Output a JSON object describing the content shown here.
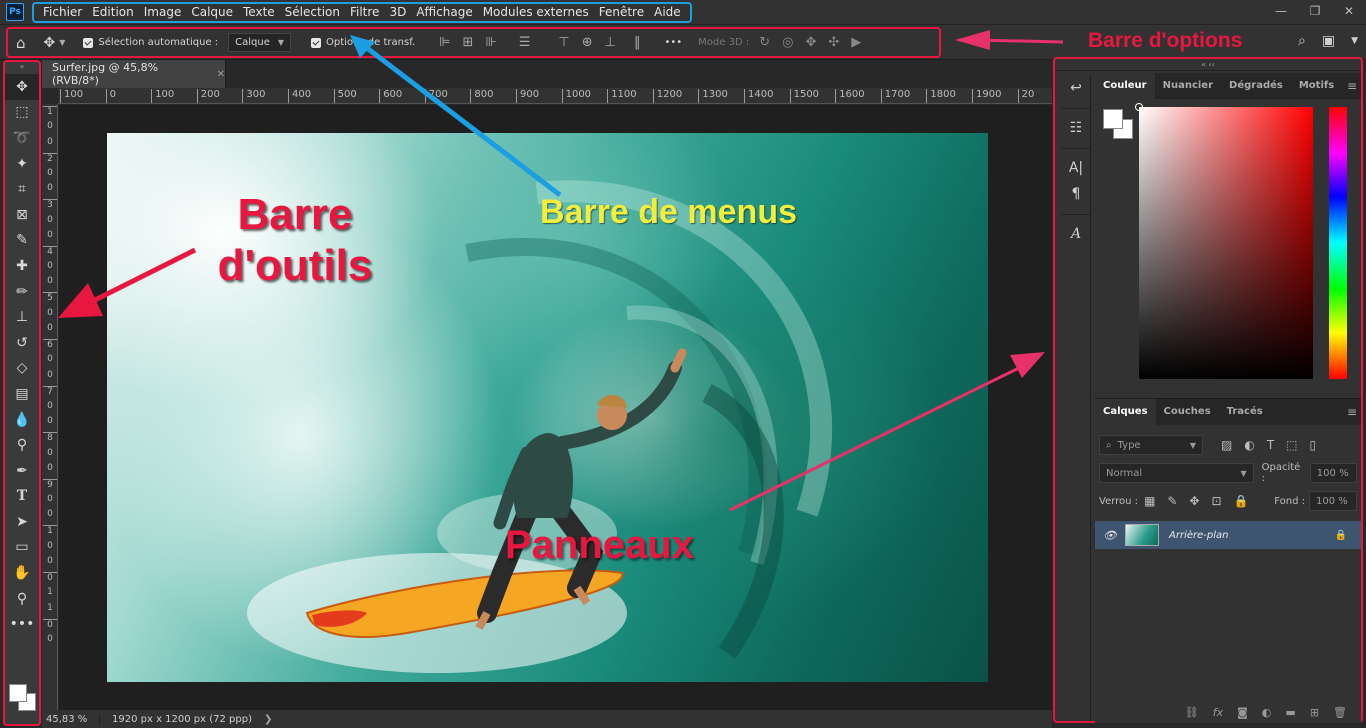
{
  "app": {
    "logo": "Ps"
  },
  "menu": {
    "items": [
      "Fichier",
      "Edition",
      "Image",
      "Calque",
      "Texte",
      "Sélection",
      "Filtre",
      "3D",
      "Affichage",
      "Modules externes",
      "Fenêtre",
      "Aide"
    ]
  },
  "window_controls": {
    "minimize": "—",
    "restore": "❐",
    "close": "✕"
  },
  "options": {
    "auto_select": "Sélection automatique :",
    "layer_dropdown": "Calque",
    "transform_controls": "Options de transf.",
    "mode3d": "Mode 3D :",
    "more": "•••"
  },
  "document": {
    "tab_title": "Surfer.jpg @ 45,8% (RVB/8*)",
    "ruler_h": [
      "100",
      "0",
      "100",
      "200",
      "300",
      "400",
      "500",
      "600",
      "700",
      "800",
      "900",
      "1000",
      "1100",
      "1200",
      "1300",
      "1400",
      "1500",
      "1600",
      "1700",
      "1800",
      "1900",
      "20"
    ],
    "ruler_v": [
      "1",
      "0",
      "0",
      "2",
      "0",
      "0",
      "3",
      "0",
      "0",
      "4",
      "0",
      "0",
      "5",
      "0",
      "0",
      "6",
      "0",
      "0",
      "7",
      "0",
      "0",
      "8",
      "0",
      "0",
      "9",
      "0",
      "0",
      "1",
      "0",
      "0",
      "0",
      "1",
      "1",
      "0",
      "0"
    ]
  },
  "annotations": {
    "outils_line1": "Barre",
    "outils_line2": "d'outils",
    "menus": "Barre de menus",
    "panneaux": "Panneaux",
    "options": "Barre d'options"
  },
  "status": {
    "zoom": "45,83 %",
    "info": "1920 px x 1200 px (72 ppp)",
    "arrow": "❯"
  },
  "color_tabs": [
    "Couleur",
    "Nuancier",
    "Dégradés",
    "Motifs"
  ],
  "layers": {
    "tabs": [
      "Calques",
      "Couches",
      "Tracés"
    ],
    "filter_placeholder": "Type",
    "blend_mode": "Normal",
    "opacity_label": "Opacité :",
    "opacity_value": "100 %",
    "lock_label": "Verrou :",
    "fill_label": "Fond :",
    "fill_value": "100 %",
    "layer_name": "Arrière-plan"
  },
  "colors": {
    "annotation_red": "#e8173f",
    "annotation_blue": "#1a9fe5",
    "annotation_yellow": "#f2ee3b",
    "arrow_pink": "#e8306a"
  }
}
